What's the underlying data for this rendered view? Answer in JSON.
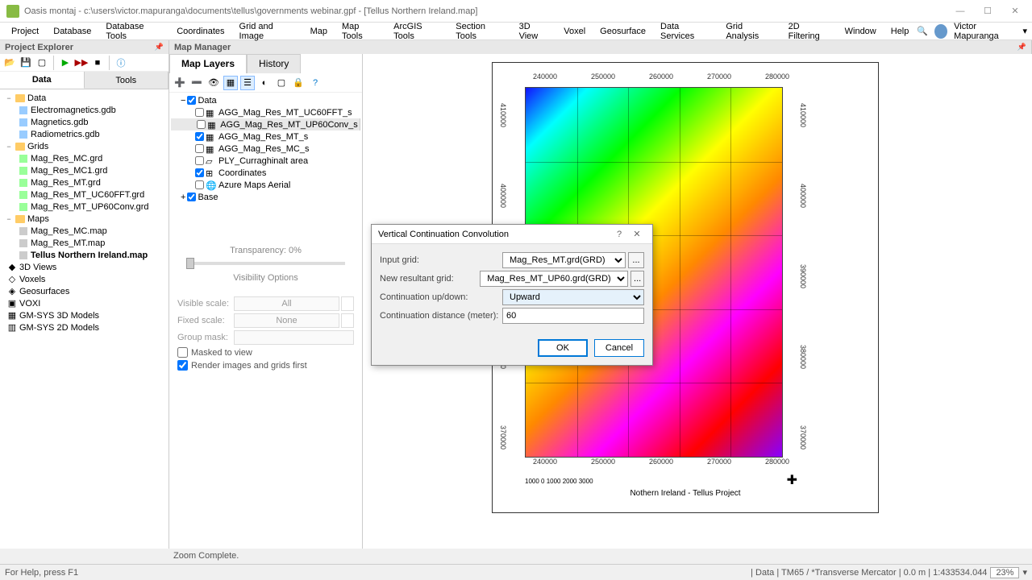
{
  "titlebar": {
    "text": "Oasis montaj - c:\\users\\victor.mapuranga\\documents\\tellus\\governments webinar.gpf - [Tellus Northern Ireland.map]"
  },
  "menubar": {
    "items": [
      "Project",
      "Database",
      "Database Tools",
      "Coordinates",
      "Grid and Image",
      "Map",
      "Map Tools",
      "ArcGIS Tools",
      "Section Tools",
      "3D View",
      "Voxel",
      "Geosurface",
      "Data Services",
      "Grid Analysis",
      "2D Filtering",
      "Window",
      "Help"
    ],
    "user": "Victor Mapuranga"
  },
  "panels": {
    "explorer_title": "Project Explorer",
    "map_manager_title": "Map Manager"
  },
  "explorer": {
    "tabs": [
      "Data",
      "Tools"
    ],
    "tree": {
      "data_folder": "Data",
      "databases": [
        {
          "name": "Electromagnetics.gdb"
        },
        {
          "name": "Magnetics.gdb"
        },
        {
          "name": "Radiometrics.gdb"
        }
      ],
      "grids_folder": "Grids",
      "grids": [
        {
          "name": "Mag_Res_MC.grd"
        },
        {
          "name": "Mag_Res_MC1.grd"
        },
        {
          "name": "Mag_Res_MT.grd"
        },
        {
          "name": "Mag_Res_MT_UC60FFT.grd"
        },
        {
          "name": "Mag_Res_MT_UP60Conv.grd"
        }
      ],
      "maps_folder": "Maps",
      "maps": [
        {
          "name": "Mag_Res_MC.map"
        },
        {
          "name": "Mag_Res_MT.map"
        },
        {
          "name": "Tellus Northern Ireland.map",
          "bold": true
        }
      ],
      "views3d": "3D Views",
      "voxels": "Voxels",
      "geosurfaces": "Geosurfaces",
      "voxi": "VOXI",
      "gmsys3d": "GM-SYS 3D Models",
      "gmsys2d": "GM-SYS 2D Models"
    }
  },
  "map_manager": {
    "tabs": [
      "Map Layers",
      "History"
    ],
    "layers": {
      "data": "Data",
      "items": [
        {
          "name": "AGG_Mag_Res_MT_UC60FFT_s",
          "checked": false
        },
        {
          "name": "AGG_Mag_Res_MT_UP60Conv_s",
          "checked": false
        },
        {
          "name": "AGG_Mag_Res_MT_s",
          "checked": true
        },
        {
          "name": "AGG_Mag_Res_MC_s",
          "checked": false
        },
        {
          "name": "PLY_Curraghinalt area",
          "checked": false
        },
        {
          "name": "Coordinates",
          "checked": true
        },
        {
          "name": "Azure Maps Aerial",
          "checked": false
        }
      ],
      "base": "Base"
    },
    "transparency": "Transparency: 0%",
    "visibility_title": "Visibility Options",
    "visible_scale_label": "Visible scale:",
    "visible_scale_value": "All",
    "fixed_scale_label": "Fixed scale:",
    "fixed_scale_value": "None",
    "group_mask_label": "Group mask:",
    "masked_label": "Masked to view",
    "render_label": "Render images and grids first"
  },
  "map": {
    "x_ticks": [
      "240000",
      "250000",
      "260000",
      "270000",
      "280000"
    ],
    "y_ticks": [
      "370000",
      "380000",
      "390000",
      "400000",
      "410000"
    ],
    "title": "Nothern Ireland - Tellus Project",
    "scale": "1000   0   1000   2000   3000"
  },
  "dialog": {
    "title": "Vertical Continuation Convolution",
    "input_grid_label": "Input grid:",
    "input_grid_value": "Mag_Res_MT.grd(GRD)",
    "new_grid_label": "New resultant grid:",
    "new_grid_value": "Mag_Res_MT_UP60.grd(GRD)",
    "direction_label": "Continuation up/down:",
    "direction_value": "Upward",
    "distance_label": "Continuation distance (meter):",
    "distance_value": "60",
    "ok": "OK",
    "cancel": "Cancel"
  },
  "statusbar": {
    "help": "For Help, press F1",
    "zoom_complete": "Zoom Complete.",
    "info": "| Data | TM65 / *Transverse Mercator | 0.0 m | 1:433534.044",
    "zoom": "23%"
  }
}
